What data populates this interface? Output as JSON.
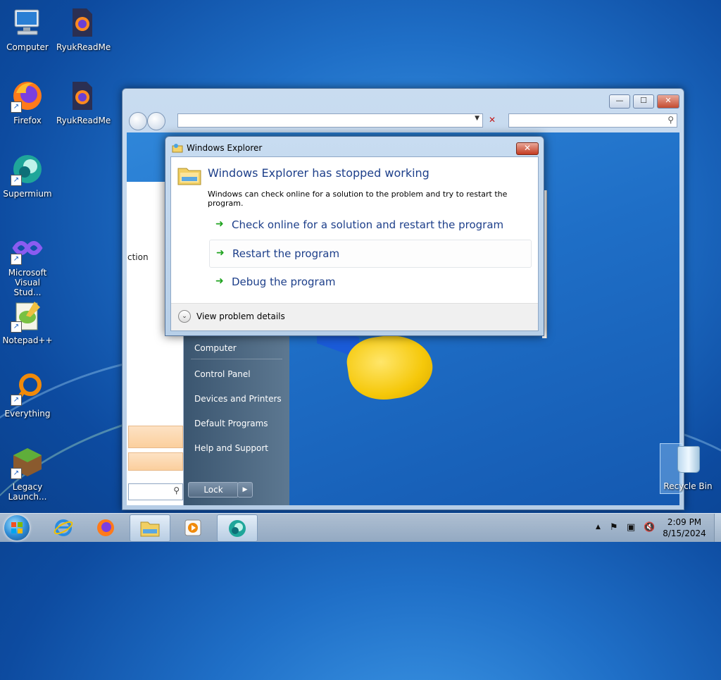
{
  "desktop": {
    "icons": [
      {
        "label": "Computer",
        "icon": "computer-icon"
      },
      {
        "label": "RyukReadMe",
        "icon": "firefox-file-icon"
      },
      {
        "label": "Firefox",
        "icon": "firefox-icon"
      },
      {
        "label": "RyukReadMe",
        "icon": "firefox-file-icon"
      },
      {
        "label": "Supermium",
        "icon": "supermium-icon"
      },
      {
        "label": "Microsoft Visual Stud...",
        "icon": "visual-studio-icon"
      },
      {
        "label": "Notepad++",
        "icon": "notepadpp-icon"
      },
      {
        "label": "Everything",
        "icon": "everything-icon"
      },
      {
        "label": "Legacy Launch...",
        "icon": "minecraft-icon"
      }
    ],
    "recycle_bin": {
      "label": "Recycle Bin"
    }
  },
  "explorer_window": {
    "controls": {
      "minimize": "—",
      "maximize": "☐",
      "close": "✕"
    },
    "start_menu_fragment": {
      "left_text_fragment": "ction",
      "right_items": [
        "Computer",
        "Control Panel",
        "Devices and Printers",
        "Default Programs",
        "Help and Support"
      ],
      "lock_label": "Lock",
      "lock_arrow": "▶"
    }
  },
  "dialog": {
    "title": "Windows Explorer",
    "heading": "Windows Explorer has stopped working",
    "description": "Windows can check online for a solution to the problem and try to restart the program.",
    "options": [
      {
        "label": "Check online for a solution and restart the program"
      },
      {
        "label": "Restart the program"
      },
      {
        "label": "Debug the program"
      }
    ],
    "details_label": "View problem details",
    "close_glyph": "✕",
    "chevron_glyph": "⌄",
    "arrow_glyph": "➜"
  },
  "taskbar": {
    "clock_time": "2:09 PM",
    "clock_date": "8/15/2024",
    "tray_glyphs": {
      "show_hidden": "▲",
      "flag": "⚑",
      "network": "▣",
      "volume": "🔇"
    }
  },
  "colors": {
    "dialog_heading": "#1d3f8a",
    "option_arrow": "#1fa31f",
    "close_button": "#c43b21"
  }
}
